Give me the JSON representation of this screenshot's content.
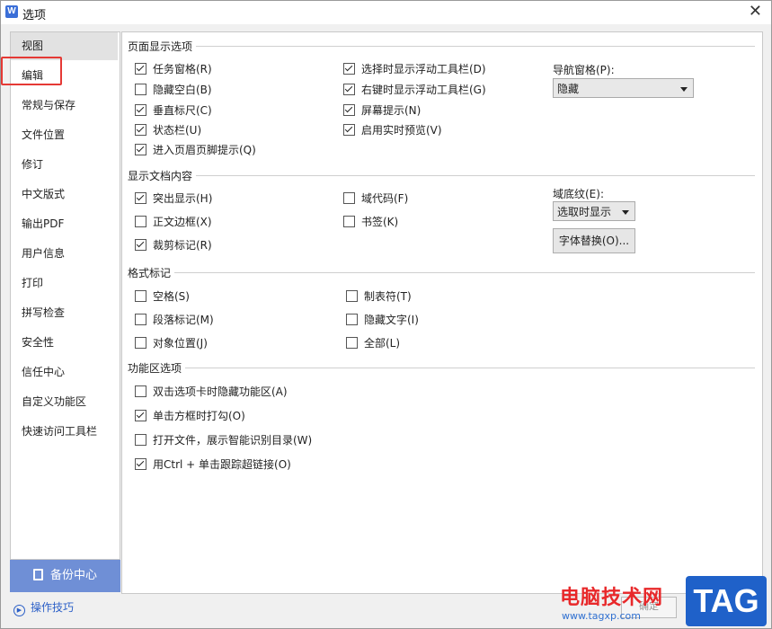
{
  "window": {
    "title": "选项",
    "app_icon": "W"
  },
  "sidebar": {
    "items": [
      {
        "label": "视图"
      },
      {
        "label": "编辑"
      },
      {
        "label": "常规与保存"
      },
      {
        "label": "文件位置"
      },
      {
        "label": "修订"
      },
      {
        "label": "中文版式"
      },
      {
        "label": "输出PDF"
      },
      {
        "label": "用户信息"
      },
      {
        "label": "打印"
      },
      {
        "label": "拼写检查"
      },
      {
        "label": "安全性"
      },
      {
        "label": "信任中心"
      },
      {
        "label": "自定义功能区"
      },
      {
        "label": "快速访问工具栏"
      }
    ],
    "selected_index": 0,
    "backup_label": "备份中心",
    "tips_label": "操作技巧"
  },
  "page_display": {
    "title": "页面显示选项",
    "col1": [
      {
        "label": "任务窗格(R)",
        "checked": true
      },
      {
        "label": "隐藏空白(B)",
        "checked": false
      },
      {
        "label": "垂直标尺(C)",
        "checked": true
      },
      {
        "label": "状态栏(U)",
        "checked": true
      },
      {
        "label": "进入页眉页脚提示(Q)",
        "checked": true
      }
    ],
    "col2": [
      {
        "label": "选择时显示浮动工具栏(D)",
        "checked": true
      },
      {
        "label": "右键时显示浮动工具栏(G)",
        "checked": true
      },
      {
        "label": "屏幕提示(N)",
        "checked": true
      },
      {
        "label": "启用实时预览(V)",
        "checked": true
      }
    ],
    "nav_label": "导航窗格(P):",
    "nav_value": "隐藏"
  },
  "doc_content": {
    "title": "显示文档内容",
    "col1": [
      {
        "label": "突出显示(H)",
        "checked": true
      },
      {
        "label": "正文边框(X)",
        "checked": false
      },
      {
        "label": "裁剪标记(R)",
        "checked": true
      }
    ],
    "col2": [
      {
        "label": "域代码(F)",
        "checked": false
      },
      {
        "label": "书签(K)",
        "checked": false
      }
    ],
    "field_label": "域底纹(E):",
    "field_value": "选取时显示",
    "font_replace_label": "字体替换(O)..."
  },
  "format_marks": {
    "title": "格式标记",
    "col1": [
      {
        "label": "空格(S)",
        "checked": false
      },
      {
        "label": "段落标记(M)",
        "checked": false
      },
      {
        "label": "对象位置(J)",
        "checked": false
      }
    ],
    "col2": [
      {
        "label": "制表符(T)",
        "checked": false
      },
      {
        "label": "隐藏文字(I)",
        "checked": false
      },
      {
        "label": "全部(L)",
        "checked": false
      }
    ]
  },
  "ribbon": {
    "title": "功能区选项",
    "items": [
      {
        "label": "双击选项卡时隐藏功能区(A)",
        "checked": false
      },
      {
        "label": "单击方框时打勾(O)",
        "checked": true
      },
      {
        "label": "打开文件，展示智能识别目录(W)",
        "checked": false
      },
      {
        "label": "用Ctrl + 单击跟踪超链接(O)",
        "checked": true
      }
    ]
  },
  "footer": {
    "ok_label": "确定"
  },
  "watermark": {
    "site_name": "电脑技术网",
    "url": "www.tagxp.com",
    "tag": "TAG"
  }
}
